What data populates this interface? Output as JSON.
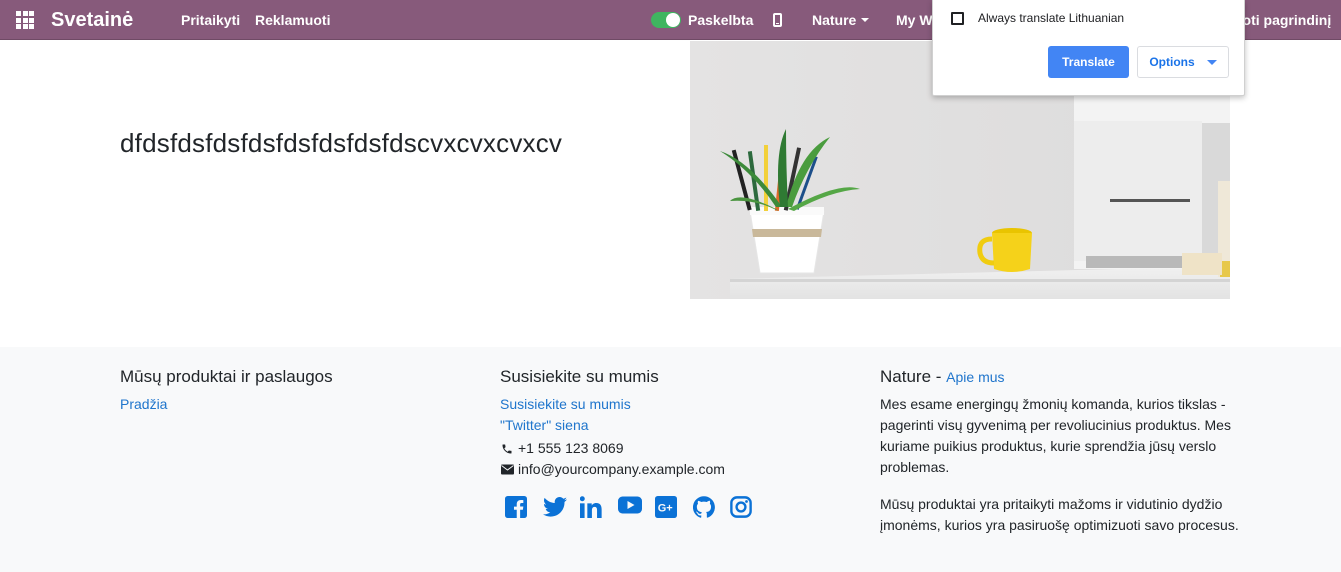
{
  "colors": {
    "navbar": "#875a7b",
    "toggle_on": "#3fb560",
    "link": "#1f75cc",
    "social": "#0b72d6",
    "footer_bg": "#f8f9fa",
    "translate_button": "#4285f4"
  },
  "navbar": {
    "apps_icon": "grid-icon",
    "brand": "Svetainė",
    "customize": "Pritaikyti",
    "promote": "Reklamuoti",
    "publish_label": "Paskelbta",
    "publish_state": "on",
    "mobile_icon": "mobile-phone-icon",
    "site_menu": "Nature",
    "my_websites": "My We",
    "edit_right": "uoti pagrindinį"
  },
  "hero": {
    "title": "dfdsfdsfdsfdsfdsfdsfdsfdscvxcvxcvxcv",
    "image": "desk-plant-mug-computer-photo"
  },
  "footer": {
    "products": {
      "heading": "Mūsų produktai ir paslaugos",
      "links": [
        "Pradžia"
      ]
    },
    "contact": {
      "heading": "Susisiekite su mumis",
      "links": [
        "Susisiekite su mumis",
        "\"Twitter\" siena"
      ],
      "phone": "+1 555 123 8069",
      "phone_icon": "phone-icon",
      "email": "info@yourcompany.example.com",
      "email_icon": "envelope-icon",
      "socials": [
        "facebook-icon",
        "twitter-icon",
        "linkedin-icon",
        "youtube-icon",
        "google-plus-icon",
        "github-icon",
        "instagram-icon"
      ]
    },
    "about": {
      "heading": "Nature",
      "separator": "-",
      "about_link": "Apie mus",
      "paragraph1": "Mes esame energingų žmonių komanda, kurios tikslas - pagerinti visų gyvenimą per revoliucinius produktus. Mes kuriame puikius produktus, kurie sprendžia jūsų verslo problemas.",
      "paragraph2": "Mūsų produktai yra pritaikyti mažoms ir vidutinio dydžio įmonėms, kurios yra pasiruošę optimizuoti savo procesus."
    }
  },
  "translate_popup": {
    "always_translate": "Always translate Lithuanian",
    "checked": false,
    "translate_button": "Translate",
    "options_button": "Options"
  }
}
